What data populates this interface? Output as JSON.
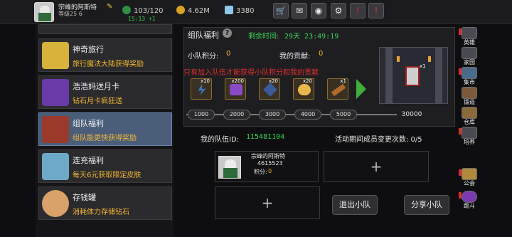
{
  "header": {
    "player_name": "宗峰的阿斯特",
    "player_sub": "等级25 6",
    "stamina": "103/120",
    "stamina_timer": "15:13 +1",
    "gold": "4.62M",
    "gems": "3380",
    "buttons": [
      "shop",
      "mail",
      "gamepad",
      "settings",
      "event",
      "exit"
    ]
  },
  "cards": [
    {
      "title": "神奇旅行",
      "subtitle": "旅行魔法大陆获得奖励",
      "icon": "ticket-icon",
      "active": false
    },
    {
      "title": "浩浩妈送月卡",
      "subtitle": "钻石月卡疯狂送",
      "icon": "purple-gem-card-icon",
      "active": false
    },
    {
      "title": "组队福利",
      "subtitle": "组队能更快获得奖励",
      "icon": "treasure-chest-icon",
      "active": true
    },
    {
      "title": "连充福利",
      "subtitle": "每天6元获取限定皮肤",
      "icon": "crystal-icon",
      "active": false
    },
    {
      "title": "存钱罐",
      "subtitle": "消耗体力存储钻石",
      "icon": "piggy-bank-icon",
      "active": false
    }
  ],
  "panel": {
    "title": "组队福利",
    "countdown_label": "剩余时间:",
    "countdown": "29天 23:49:19",
    "team_points_label": "小队积分:",
    "team_points": "0",
    "my_contrib_label": "我的贡献:",
    "my_contrib": "0",
    "warning": "只有加入队伍才能获得小队积分和我的贡献",
    "rewards": [
      {
        "count": "x10",
        "icon": "lightning-icon"
      },
      {
        "count": "x200",
        "icon": "purple-potion-icon"
      },
      {
        "count": "x20",
        "icon": "blue-gem-icon"
      },
      {
        "count": "x20",
        "icon": "golden-egg-icon"
      },
      {
        "count": "x1",
        "icon": "weapon-icon"
      }
    ],
    "scene_count": "x1",
    "milestones": [
      "1000",
      "2000",
      "3000",
      "4000",
      "5000"
    ],
    "milestone_final": "30000"
  },
  "team": {
    "id_label": "我的队伍ID:",
    "id": "115481104",
    "changes": "活动期间成员变更次数: 0/5",
    "member_name": "宗峰的阿斯特",
    "member_id": "4615523",
    "member_points_label": "积分:",
    "member_points": "0",
    "plus": "+",
    "leave_btn": "退出小队",
    "share_btn": "分享小队"
  },
  "right_nav": [
    "英雄",
    "家园",
    "集市",
    "锻造",
    "仓库",
    "培养",
    "公会",
    "跳斗"
  ],
  "colors": {
    "accent_green": "#39d353",
    "gold_text": "#f2b632",
    "warning_red": "#e0302a",
    "active_card": "#4a5e7a"
  }
}
